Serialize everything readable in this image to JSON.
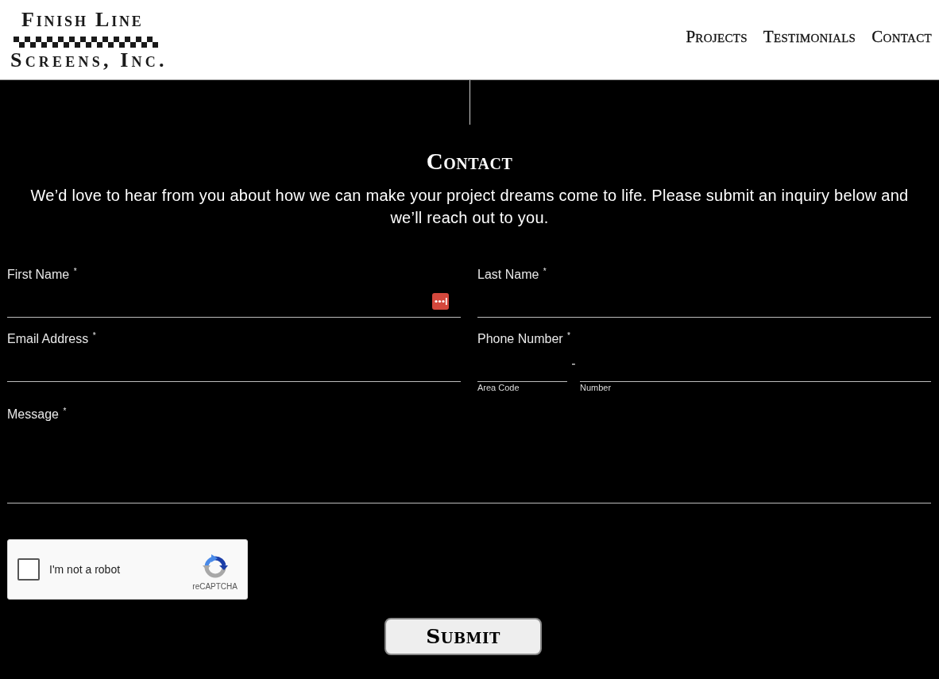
{
  "header": {
    "logo": {
      "top_line": "Finish Line",
      "bottom_line": "Screens, Inc."
    },
    "nav": [
      {
        "label": "Projects"
      },
      {
        "label": "Testimonials"
      },
      {
        "label": "Contact"
      }
    ]
  },
  "contact": {
    "title": "Contact",
    "intro": "We’d love to hear from you about how we can make your project dreams come to life. Please submit an inquiry below and we’ll reach out to you.",
    "fields": [
      {
        "kind": "text",
        "label": "First Name $^{*}$",
        "password_badge": true
      },
      {
        "kind": "text",
        "label": "Last Name $^{*}$",
        "password_badge": false
      },
      {
        "kind": "email",
        "label": "Email Address $^{*}$",
        "password_badge": false
      },
      {
        "kind": "phone",
        "label": "Phone Number $^{*}$",
        "separator": "-",
        "captions": [
          "Area Code",
          "Number"
        ],
        "password_badge": false
      },
      {
        "kind": "textarea",
        "label": "Message $^{*}$",
        "password_badge": false
      }
    ],
    "recaptcha": {
      "label": "I'm not a robot",
      "brand": "reCAPTCHA",
      "checked": false
    },
    "submit": {
      "label": "Submit"
    }
  }
}
